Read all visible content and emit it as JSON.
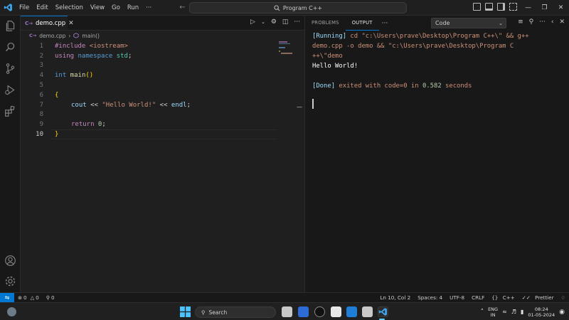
{
  "window": {
    "menu": [
      "File",
      "Edit",
      "Selection",
      "View",
      "Go",
      "Run",
      "···"
    ],
    "command_center": "Program C++"
  },
  "editor": {
    "tab_label": "demo.cpp",
    "tab_lang": "C→",
    "breadcrumb_file": "demo.cpp",
    "breadcrumb_sep": "›",
    "breadcrumb_symbol": "main()",
    "active_line": 10,
    "line_numbers": [
      "1",
      "2",
      "3",
      "4",
      "5",
      "6",
      "7",
      "8",
      "9",
      "10"
    ],
    "code": {
      "l1_a": "#include",
      "l1_b": " <iostream>",
      "l2_a": "using",
      "l2_b": " namespace",
      "l2_c": " std",
      "l2_d": ";",
      "l4_a": "int",
      "l4_b": " main",
      "l4_c": "()",
      "l6_a": "{",
      "l7_a": "cout",
      "l7_b": " << ",
      "l7_c": "\"Hello World!\"",
      "l7_d": " << ",
      "l7_e": "endl",
      "l7_f": ";",
      "l9_a": "return",
      "l9_b": " 0",
      "l9_c": ";",
      "l10_a": "}"
    }
  },
  "panel": {
    "tabs": [
      "PROBLEMS",
      "OUTPUT"
    ],
    "active_tab": "OUTPUT",
    "more": "···",
    "channel": "Code",
    "output": {
      "running_tag": "[Running]",
      "running_cmd": " cd \"c:\\Users\\prave\\Desktop\\Program C++\\\" && g++",
      "running_cmd_2": "demo.cpp -o demo && \"c:\\Users\\prave\\Desktop\\Program C",
      "running_cmd_3": "++\\\"demo",
      "hello": "Hello World!",
      "done_tag": "[Done]",
      "done_text_a": " exited with ",
      "done_text_b": "code=0",
      "done_text_c": " in ",
      "done_text_d": "0.582",
      "done_text_e": " seconds"
    }
  },
  "statusbar": {
    "errors": "0",
    "warnings": "0",
    "ports": "0",
    "cursor": "Ln 10, Col 2",
    "spaces": "Spaces: 4",
    "encoding": "UTF-8",
    "eol": "CRLF",
    "language": "C++",
    "formatter": "Prettier"
  },
  "taskbar": {
    "search": "Search",
    "lang_top": "ENG",
    "lang_bottom": "IN",
    "time": "08:24",
    "date": "01-05-2024"
  },
  "colors": {
    "accent": "#0078d4",
    "keyword": "#569cd6",
    "preprocessor": "#c586c0",
    "function": "#dcdcaa",
    "string": "#ce9178",
    "number": "#b5cea8",
    "bracket": "#ffd700"
  }
}
